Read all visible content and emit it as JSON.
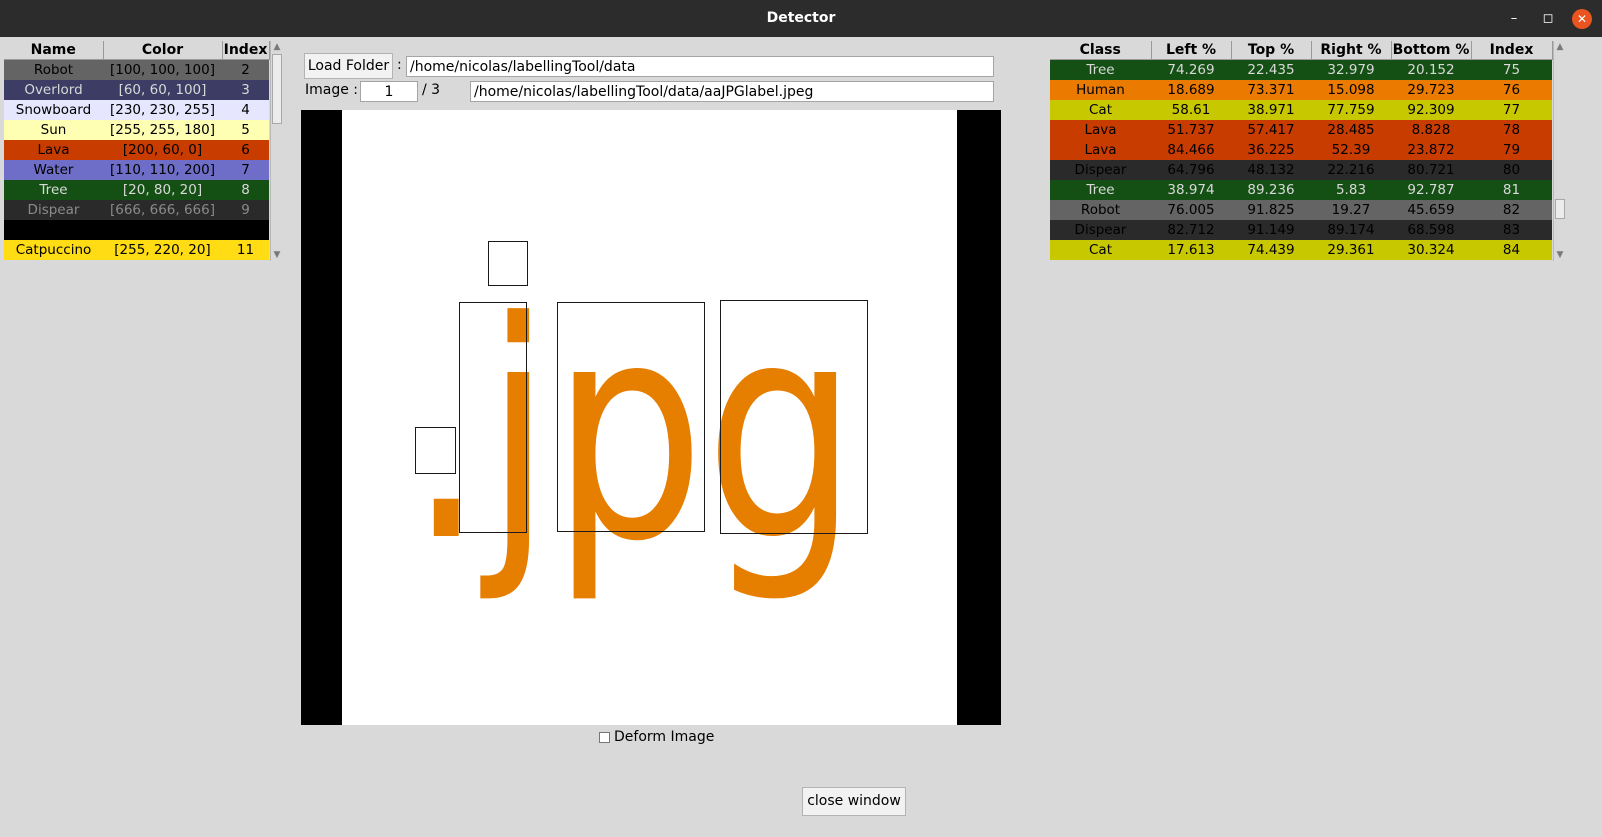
{
  "window": {
    "title": "Detector",
    "minimize_icon": "minimize-icon",
    "maximize_icon": "maximize-icon",
    "close_icon": "close-icon"
  },
  "class_table": {
    "headers": [
      "Name",
      "Color",
      "Index"
    ],
    "rows": [
      {
        "name": "Robot",
        "color": "[100, 100, 100]",
        "index": "2",
        "bg": "#646464",
        "fg": "#000000"
      },
      {
        "name": "Overlord",
        "color": "[60, 60, 100]",
        "index": "3",
        "bg": "#3c3c64",
        "fg": "#d8d8d8"
      },
      {
        "name": "Snowboard",
        "color": "[230, 230, 255]",
        "index": "4",
        "bg": "#e6e6ff",
        "fg": "#000000"
      },
      {
        "name": "Sun",
        "color": "[255, 255, 180]",
        "index": "5",
        "bg": "#ffffb4",
        "fg": "#000000"
      },
      {
        "name": "Lava",
        "color": "[200, 60, 0]",
        "index": "6",
        "bg": "#c83c00",
        "fg": "#000000"
      },
      {
        "name": "Water",
        "color": "[110, 110, 200]",
        "index": "7",
        "bg": "#6e6ec8",
        "fg": "#000000"
      },
      {
        "name": "Tree",
        "color": "[20, 80, 20]",
        "index": "8",
        "bg": "#145014",
        "fg": "#d8d8d8"
      },
      {
        "name": "Dispear",
        "color": "[666, 666, 666]",
        "index": "9",
        "bg": "#2a2a2a",
        "fg": "#8a8a8a"
      },
      {
        "name": "",
        "color": "",
        "index": "",
        "bg": "#000000",
        "fg": "#000000"
      },
      {
        "name": "Catpuccino",
        "color": "[255, 220, 20]",
        "index": "11",
        "bg": "#ffdc14",
        "fg": "#000000"
      }
    ]
  },
  "toolbar": {
    "load_folder_label": "Load Folder",
    "separator": ":",
    "folder_path": "/home/nicolas/labellingTool/data",
    "image_label": "Image :",
    "image_number": "1",
    "image_total": "/ 3",
    "image_path": "/home/nicolas/labellingTool/data/aaJPGlabel.jpeg"
  },
  "bbox_table": {
    "headers": [
      "Class",
      "Left %",
      "Top %",
      "Right %",
      "Bottom %",
      "Index"
    ],
    "rows": [
      {
        "cls": "Tree",
        "left": "74.269",
        "top": "22.435",
        "right": "32.979",
        "bottom": "20.152",
        "index": "75",
        "bg": "#145014",
        "fg": "#d8d8d8"
      },
      {
        "cls": "Human",
        "left": "18.689",
        "top": "73.371",
        "right": "15.098",
        "bottom": "29.723",
        "index": "76",
        "bg": "#ea7b00",
        "fg": "#000000"
      },
      {
        "cls": "Cat",
        "left": "58.61",
        "top": "38.971",
        "right": "77.759",
        "bottom": "92.309",
        "index": "77",
        "bg": "#c8c800",
        "fg": "#000000"
      },
      {
        "cls": "Lava",
        "left": "51.737",
        "top": "57.417",
        "right": "28.485",
        "bottom": "8.828",
        "index": "78",
        "bg": "#c83c00",
        "fg": "#000000"
      },
      {
        "cls": "Lava",
        "left": "84.466",
        "top": "36.225",
        "right": "52.39",
        "bottom": "23.872",
        "index": "79",
        "bg": "#c83c00",
        "fg": "#000000"
      },
      {
        "cls": "Dispear",
        "left": "64.796",
        "top": "48.132",
        "right": "22.216",
        "bottom": "80.721",
        "index": "80",
        "bg": "#2a2a2a",
        "fg": "#000000"
      },
      {
        "cls": "Tree",
        "left": "38.974",
        "top": "89.236",
        "right": "5.83",
        "bottom": "92.787",
        "index": "81",
        "bg": "#145014",
        "fg": "#d8d8d8"
      },
      {
        "cls": "Robot",
        "left": "76.005",
        "top": "91.825",
        "right": "19.27",
        "bottom": "45.659",
        "index": "82",
        "bg": "#646464",
        "fg": "#000000"
      },
      {
        "cls": "Dispear",
        "left": "82.712",
        "top": "91.149",
        "right": "89.174",
        "bottom": "68.598",
        "index": "83",
        "bg": "#2a2a2a",
        "fg": "#000000"
      },
      {
        "cls": "Cat",
        "left": "17.613",
        "top": "74.439",
        "right": "29.361",
        "bottom": "30.324",
        "index": "84",
        "bg": "#c8c800",
        "fg": "#000000"
      }
    ]
  },
  "canvas": {
    "image_text": ".jpg",
    "text_color": "#e67e00"
  },
  "deform_checkbox": {
    "label": "Deform Image",
    "checked": false
  },
  "close_button": {
    "label": "close window"
  }
}
